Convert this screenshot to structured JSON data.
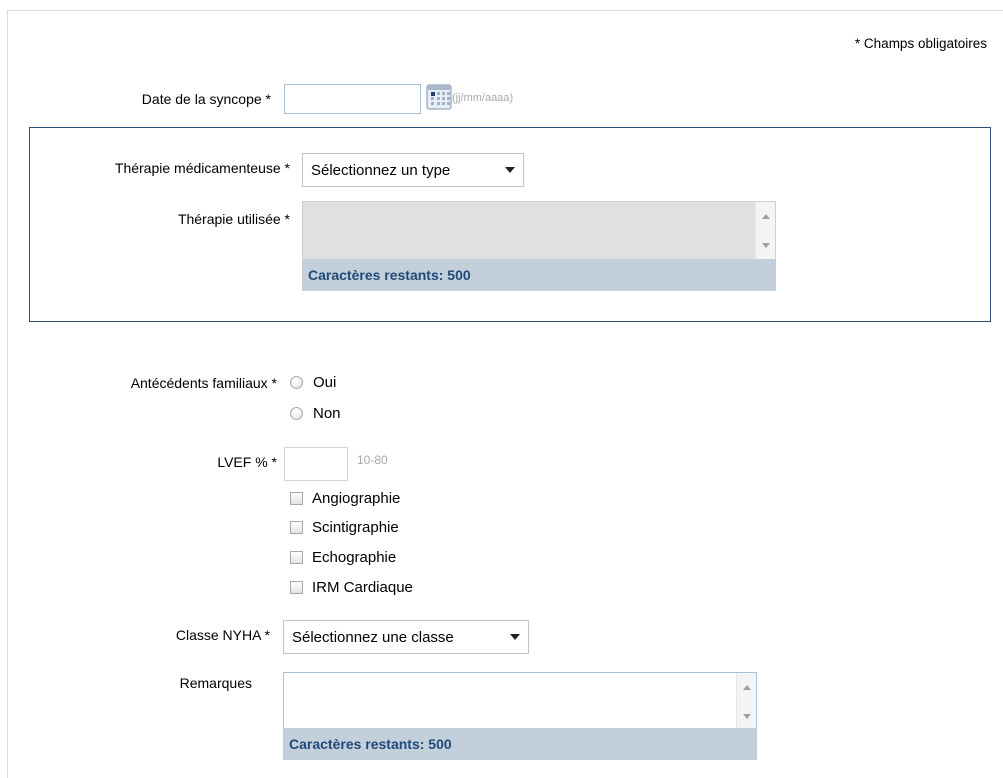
{
  "form": {
    "mandatory_note": "* Champs obligatoires",
    "date": {
      "label": "Date de la syncope *",
      "value": "",
      "hint": "(jj/mm/aaaa)"
    },
    "therapy_group": {
      "drug_therapy": {
        "label": "Thérapie médicamenteuse *",
        "selected": "Sélectionnez un type"
      },
      "therapy_used": {
        "label": "Thérapie utilisée *",
        "counter": "Caractères restants: 500"
      }
    },
    "family_history": {
      "label": "Antécédents familiaux *",
      "options": [
        "Oui",
        "Non"
      ]
    },
    "lvef": {
      "label": "LVEF % *",
      "value": "",
      "hint": "10-80",
      "methods": [
        "Angiographie",
        "Scintigraphie",
        "Echographie",
        "IRM Cardiaque"
      ]
    },
    "nyha": {
      "label": "Classe NYHA *",
      "selected": "Sélectionnez une classe"
    },
    "remarks": {
      "label": "Remarques",
      "counter": "Caractères restants: 500"
    }
  },
  "colors": {
    "group_border": "#2a4f74",
    "counter_bg": "#c4cfdc",
    "counter_text": "#1f4a78",
    "input_border": "#a9bfd6",
    "disabled_bg": "#e0e0e0"
  },
  "icons": {
    "date_picker": "calendar-icon",
    "select_arrow": "chevron-down-icon",
    "scroll_up": "scroll-up-arrow-icon",
    "scroll_down": "scroll-down-arrow-icon"
  }
}
